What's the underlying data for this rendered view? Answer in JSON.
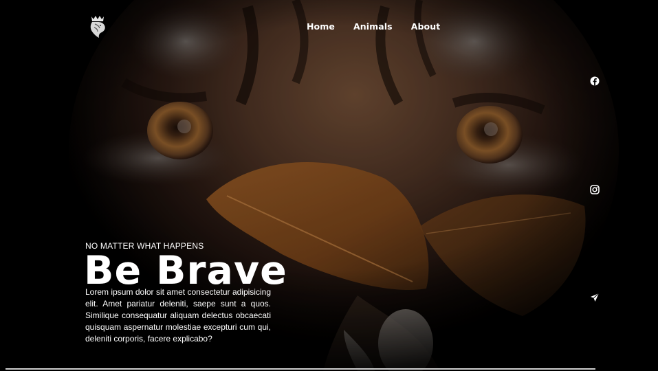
{
  "nav": {
    "logo_icon": "lion-crown-logo-icon",
    "links": [
      {
        "label": "Home"
      },
      {
        "label": "Animals"
      },
      {
        "label": "About"
      }
    ]
  },
  "social": {
    "items": [
      {
        "icon": "facebook-icon"
      },
      {
        "icon": "instagram-icon"
      },
      {
        "icon": "send-icon"
      }
    ]
  },
  "hero": {
    "tagline": "NO MATTER WHAT HAPPENS",
    "headline": "Be Brave",
    "body": "Lorem ipsum dolor sit amet consectetur adipisicing elit. Amet pariatur deleniti, saepe sunt a quos. Similique consequatur aliquam delectus obcaecati quisquam aspernatur molestiae excepturi cum qui, deleniti corporis, facere explicabo?",
    "background_image": "tiger-eyes-behind-autumn-leaves"
  },
  "colors": {
    "background": "#000000",
    "text": "#ffffff",
    "accent_leaf": "#8a4e1c",
    "fur": "#5a3a22"
  }
}
